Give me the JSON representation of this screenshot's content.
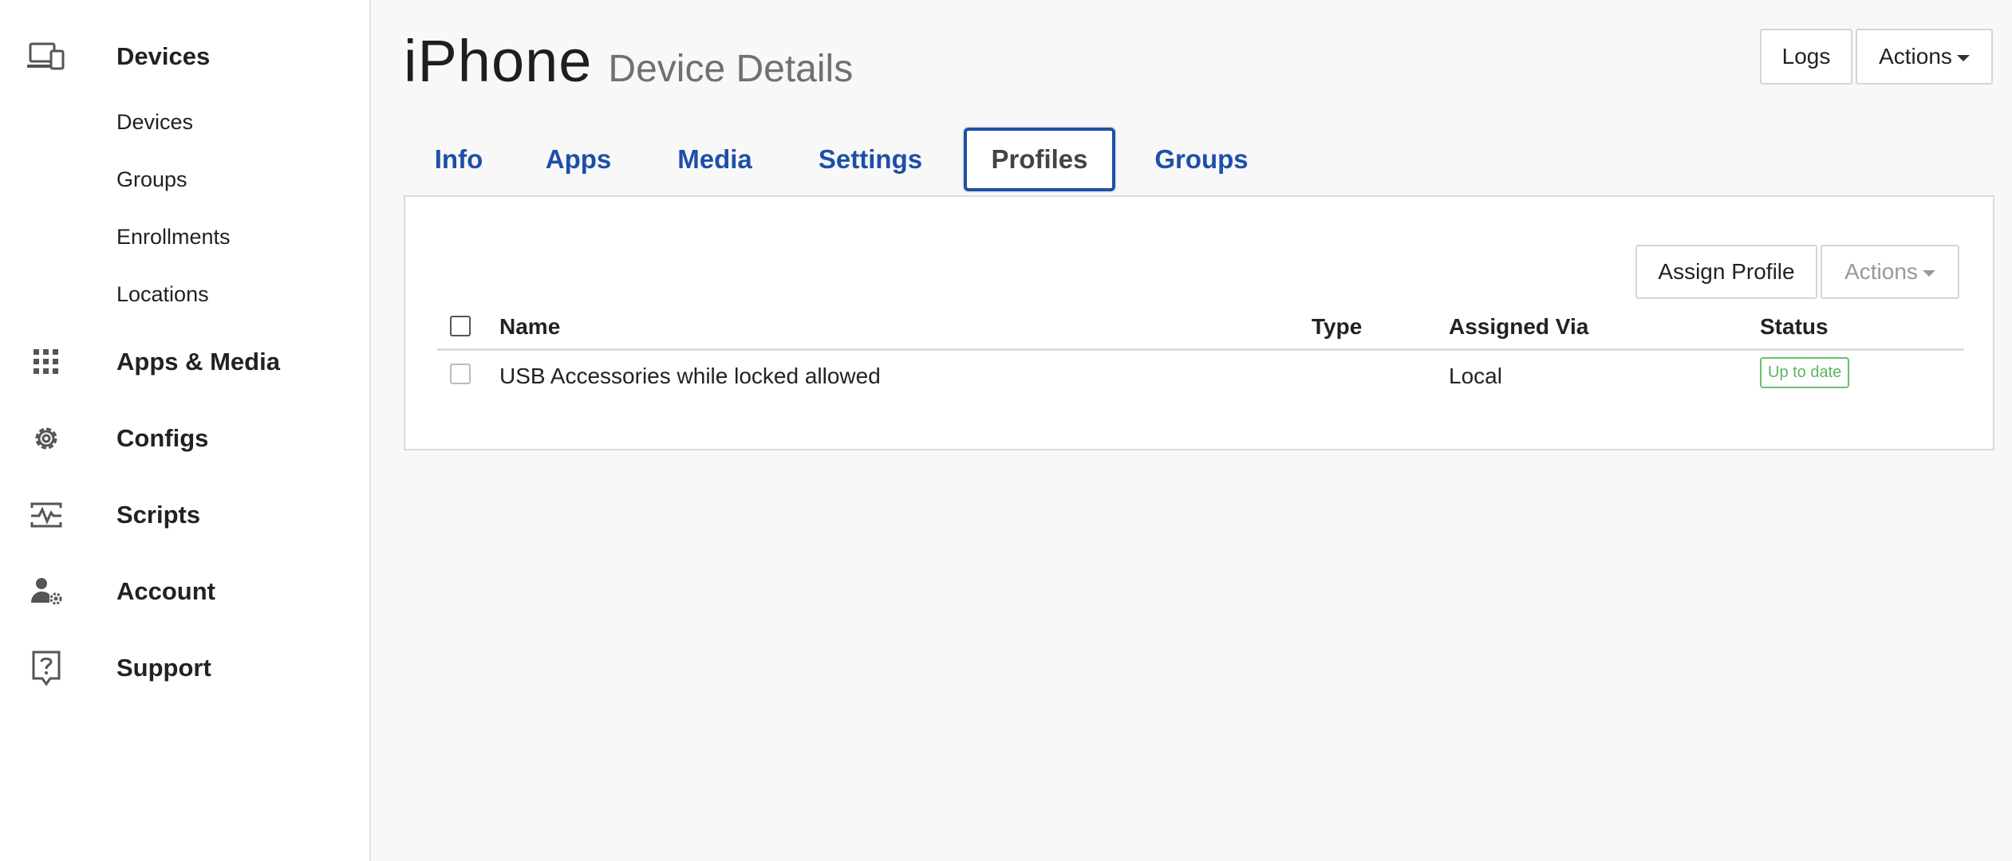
{
  "sidebar": {
    "devices": {
      "label": "Devices",
      "icon": "devices-icon"
    },
    "sub_items": [
      {
        "label": "Devices"
      },
      {
        "label": "Groups"
      },
      {
        "label": "Enrollments"
      },
      {
        "label": "Locations"
      }
    ],
    "apps_media": {
      "label": "Apps & Media",
      "icon": "grid-icon"
    },
    "configs": {
      "label": "Configs",
      "icon": "gear-icon"
    },
    "scripts": {
      "label": "Scripts",
      "icon": "script-icon"
    },
    "account": {
      "label": "Account",
      "icon": "account-gear-icon"
    },
    "support": {
      "label": "Support",
      "icon": "help-icon"
    }
  },
  "header": {
    "title": "iPhone",
    "subtitle": "Device Details",
    "logs_label": "Logs",
    "actions_label": "Actions"
  },
  "tabs": [
    {
      "label": "Info"
    },
    {
      "label": "Apps"
    },
    {
      "label": "Media"
    },
    {
      "label": "Settings"
    },
    {
      "label": "Profiles"
    },
    {
      "label": "Groups"
    }
  ],
  "active_tab": "Profiles",
  "profiles": {
    "assign_label": "Assign Profile",
    "actions_label": "Actions",
    "columns": {
      "name": "Name",
      "type": "Type",
      "assigned_via": "Assigned Via",
      "status": "Status"
    },
    "rows": [
      {
        "name": "USB Accessories while locked allowed",
        "type": "",
        "assigned_via": "Local",
        "status": "Up to date"
      }
    ]
  },
  "colors": {
    "link": "#1d4fa8",
    "status_ok": "#5fb35f"
  }
}
